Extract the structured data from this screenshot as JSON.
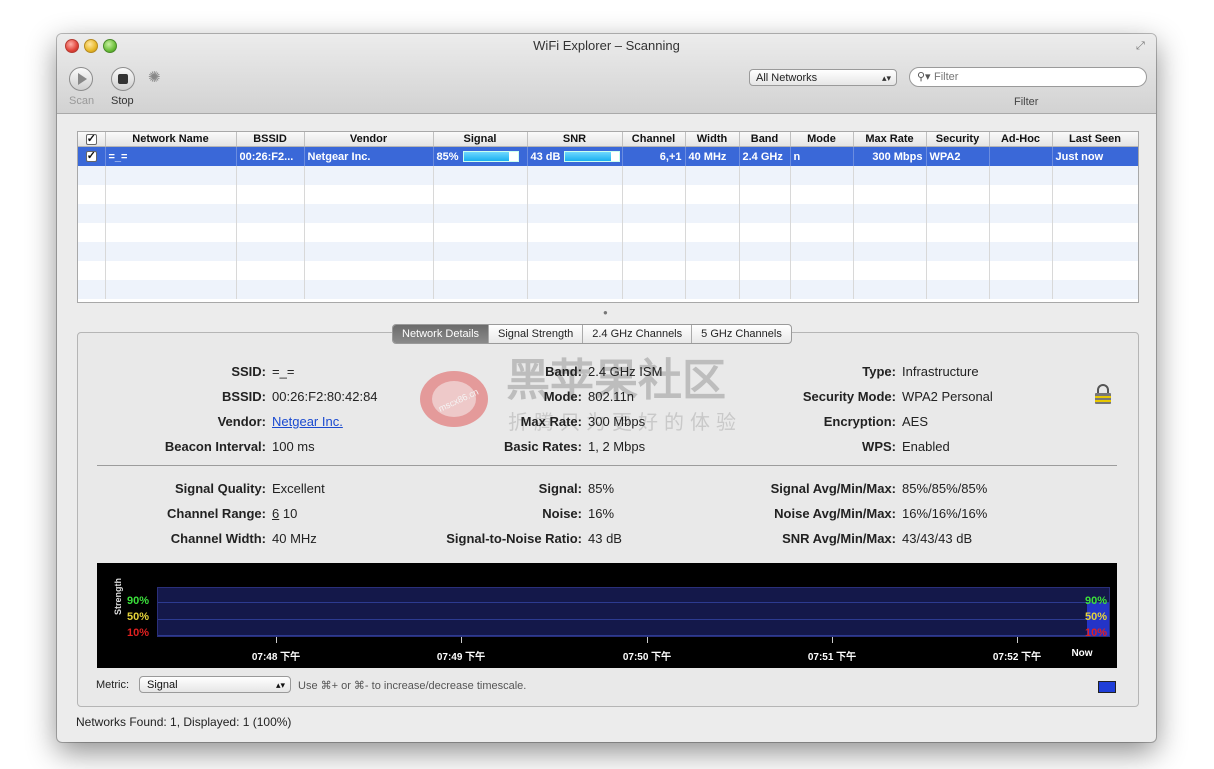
{
  "window": {
    "title": "WiFi Explorer – Scanning"
  },
  "toolbar": {
    "scan_label": "Scan",
    "stop_label": "Stop",
    "network_filter": "All Networks",
    "filter_placeholder": "Filter",
    "filter_label": "Filter"
  },
  "table": {
    "columns": [
      "Network Name",
      "BSSID",
      "Vendor",
      "Signal",
      "SNR",
      "Channel",
      "Width",
      "Band",
      "Mode",
      "Max Rate",
      "Security",
      "Ad-Hoc",
      "Last Seen"
    ],
    "rows": [
      {
        "name": "=_=",
        "bssid": "00:26:F2...",
        "vendor": "Netgear Inc.",
        "signal": "85%",
        "signal_level": 0.85,
        "snr": "43 dB",
        "snr_level": 0.85,
        "channel": "6,+1",
        "width": "40 MHz",
        "band": "2.4 GHz",
        "mode": "n",
        "max_rate": "300 Mbps",
        "security": "WPA2",
        "adhoc": "",
        "last_seen": "Just now"
      }
    ]
  },
  "tabs": [
    "Network Details",
    "Signal Strength",
    "2.4 GHz Channels",
    "5 GHz Channels"
  ],
  "details": {
    "ssid_label": "SSID:",
    "ssid": "=_=",
    "bssid_label": "BSSID:",
    "bssid": "00:26:F2:80:42:84",
    "vendor_label": "Vendor:",
    "vendor": "Netgear Inc.",
    "beacon_label": "Beacon Interval:",
    "beacon": "100 ms",
    "band_label": "Band:",
    "band": "2.4 GHz ISM",
    "mode_label": "Mode:",
    "mode": "802.11n",
    "maxrate_label": "Max Rate:",
    "maxrate": "300 Mbps",
    "basicrates_label": "Basic Rates:",
    "basicrates": "1, 2 Mbps",
    "type_label": "Type:",
    "type": "Infrastructure",
    "secmode_label": "Security Mode:",
    "secmode": "WPA2 Personal",
    "encryption_label": "Encryption:",
    "encryption": "AES",
    "wps_label": "WPS:",
    "wps": "Enabled",
    "quality_label": "Signal Quality:",
    "quality": "Excellent",
    "range_label": "Channel Range:",
    "range_primary": "6",
    "range_secondary": "10",
    "chwidth_label": "Channel Width:",
    "chwidth": "40 MHz",
    "signal_label": "Signal:",
    "signal": "85%",
    "noise_label": "Noise:",
    "noise": "16%",
    "snr_label": "Signal-to-Noise Ratio:",
    "snr": "43 dB",
    "sigavg_label": "Signal Avg/Min/Max:",
    "sigavg": "85%/85%/85%",
    "noiseavg_label": "Noise Avg/Min/Max:",
    "noiseavg": "16%/16%/16%",
    "snravg_label": "SNR Avg/Min/Max:",
    "snravg": "43/43/43 dB"
  },
  "graph": {
    "ylabel": "Strength",
    "levels": [
      "90%",
      "50%",
      "10%"
    ],
    "times": [
      "07:48 下午",
      "07:49 下午",
      "07:50 下午",
      "07:51 下午",
      "07:52 下午",
      "Now"
    ],
    "current_signal": 0.85,
    "colors": {
      "level_90": "#3be03b",
      "level_50": "#e6d43a",
      "level_10": "#e02020",
      "series": "#2434c8"
    }
  },
  "footer": {
    "metric_label": "Metric:",
    "metric": "Signal",
    "hint": "Use ⌘+ or ⌘- to increase/decrease timescale.",
    "status": "Networks Found: 1, Displayed: 1 (100%)"
  },
  "watermark": {
    "title": "黑苹果社区",
    "subtitle": "折腾只为更好的体验",
    "url": "mscx86.cn"
  },
  "icons": {
    "lock": "lock-icon",
    "search": "search-icon",
    "spinner": "spinner-icon"
  }
}
